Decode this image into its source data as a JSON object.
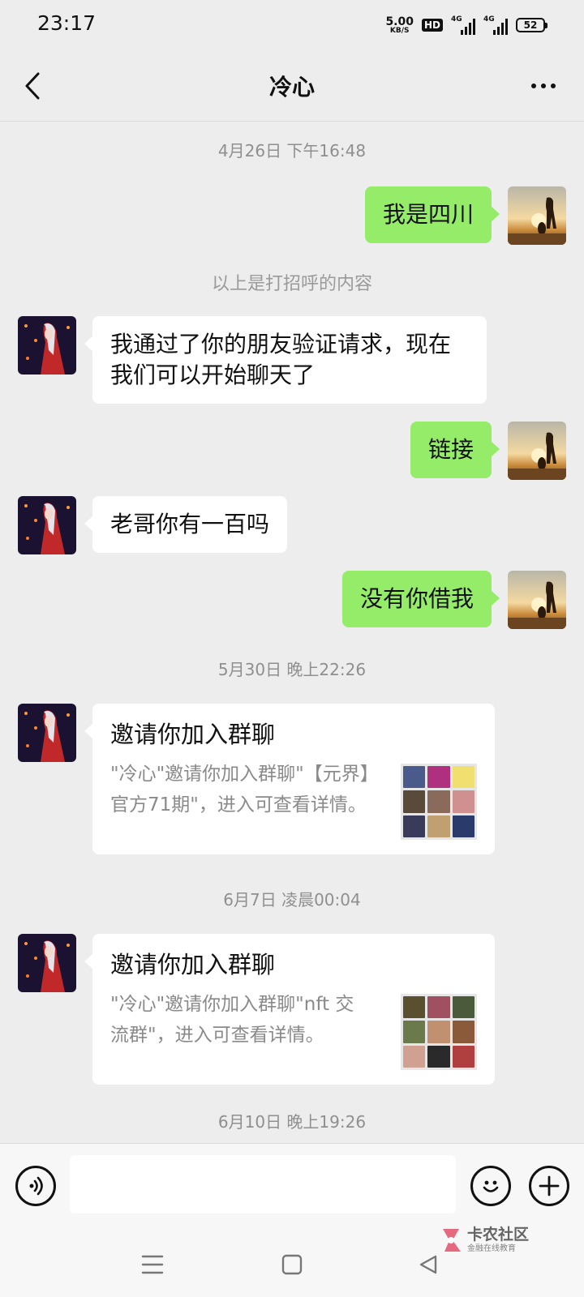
{
  "status_bar": {
    "time": "23:17",
    "net_speed_value": "5.00",
    "net_speed_unit": "KB/S",
    "hd_badge": "HD",
    "signal1_label": "4G",
    "signal2_label": "4G",
    "battery": "52"
  },
  "header": {
    "title": "冷心"
  },
  "messages": {
    "ts1": "4月26日 下午16:48",
    "m1": "我是四川",
    "sys1": "以上是打招呼的内容",
    "m2": "我通过了你的朋友验证请求，现在我们可以开始聊天了",
    "m3": "链接",
    "m4": "老哥你有一百吗",
    "m5": "没有你借我",
    "ts2": "5月30日 晚上22:26",
    "card1": {
      "title": "邀请你加入群聊",
      "desc": "\"冷心\"邀请你加入群聊\"【元界】官方71期\"，进入可查看详情。"
    },
    "ts3": "6月7日 凌晨00:04",
    "card2": {
      "title": "邀请你加入群聊",
      "desc": "\"冷心\"邀请你加入群聊\"nft 交流群\"，进入可查看详情。"
    },
    "ts4": "6月10日 晚上19:26"
  },
  "input_bar": {
    "placeholder": ""
  },
  "watermark": {
    "main": "卡农社区",
    "sub": "金融在线教育"
  },
  "icons": {
    "back": "chevron-left-icon",
    "more": "ellipsis-icon",
    "voice": "voice-icon",
    "emoji": "emoji-icon",
    "plus": "plus-icon"
  }
}
